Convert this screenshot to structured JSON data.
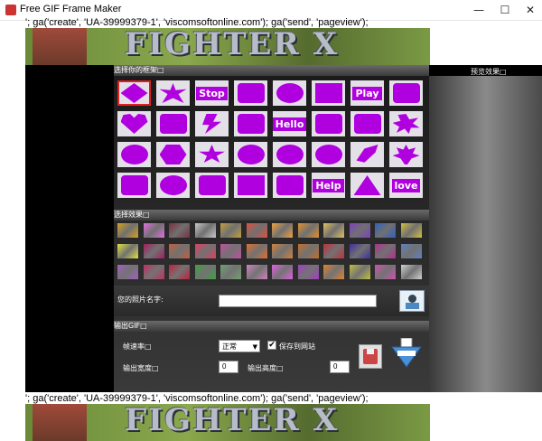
{
  "window": {
    "title": "Free GIF Frame Maker",
    "minimize_icon": "minimize-icon",
    "maximize_icon": "maximize-icon",
    "close_icon": "close-icon",
    "minimize_glyph": "—",
    "maximize_glyph": "☐",
    "close_glyph": "✕"
  },
  "js_line_top": "'; ga('create', 'UA-39999379-1', 'viscomsoftonline.com'); ga('send', 'pageview');",
  "js_line_bottom": "'; ga('create', 'UA-39999379-1', 'viscomsoftonline.com'); ga('send', 'pageview');",
  "banner": {
    "logo_text": "FIGHTER X"
  },
  "sections": {
    "choose_frame": "选择你的框架□",
    "preview": "预览效果□",
    "choose_effect": "选择效果□",
    "output_gif": "输出GIF□"
  },
  "frames": {
    "selected_index": 0,
    "items": [
      {
        "shape": "diamond"
      },
      {
        "shape": "burst"
      },
      {
        "shape": "text",
        "text": "Stop"
      },
      {
        "shape": "puzzle"
      },
      {
        "shape": "oval"
      },
      {
        "shape": "square"
      },
      {
        "shape": "text",
        "text": "Play"
      },
      {
        "shape": "rough-square"
      },
      {
        "shape": "heart"
      },
      {
        "shape": "club"
      },
      {
        "shape": "lightning"
      },
      {
        "shape": "hand"
      },
      {
        "shape": "text",
        "text": "Hello"
      },
      {
        "shape": "spade"
      },
      {
        "shape": "puzzle-piece"
      },
      {
        "shape": "star-burst"
      },
      {
        "shape": "circle"
      },
      {
        "shape": "hexagon"
      },
      {
        "shape": "star"
      },
      {
        "shape": "scalloped"
      },
      {
        "shape": "seal"
      },
      {
        "shape": "cloud"
      },
      {
        "shape": "leaf"
      },
      {
        "shape": "maple"
      },
      {
        "shape": "rough-rect"
      },
      {
        "shape": "blob"
      },
      {
        "shape": "scribble"
      },
      {
        "shape": "square"
      },
      {
        "shape": "skull"
      },
      {
        "shape": "text",
        "text": "Help"
      },
      {
        "shape": "triangle"
      },
      {
        "shape": "text",
        "text": "love"
      }
    ]
  },
  "effects": {
    "colors": [
      "#d4a020",
      "#e070e0",
      "#7a3040",
      "#c8c8c8",
      "#c0a040",
      "#e05040",
      "#f0a040",
      "#e09030",
      "#e0c060",
      "#8040c0",
      "#3060c0",
      "#d0c040",
      "#e0e040",
      "#a02060",
      "#c06040",
      "#e04060",
      "#c050a0",
      "#e07030",
      "#d08040",
      "#c07030",
      "#c03040",
      "#4030a0",
      "#b03090",
      "#6080c0",
      "#a060c0",
      "#c03060",
      "#c02040",
      "#40a040",
      "#70a070",
      "#d080c0",
      "#e060e0",
      "#a040c0",
      "#e08030",
      "#c0c040",
      "#d050b0",
      "#d0d0d0"
    ]
  },
  "photo_name": {
    "label": "您的照片名字:",
    "value": ""
  },
  "output": {
    "frame_rate_label": "帧速率□",
    "frame_rate_value": "正常",
    "save_to_web_label": "保存到网站",
    "save_to_web_checked": true,
    "width_label": "输出宽度□",
    "width_value": "0",
    "height_label": "输出高度□",
    "height_value": "0",
    "save_icon": "save-disk-icon",
    "download_icon": "download-arrow-icon"
  }
}
